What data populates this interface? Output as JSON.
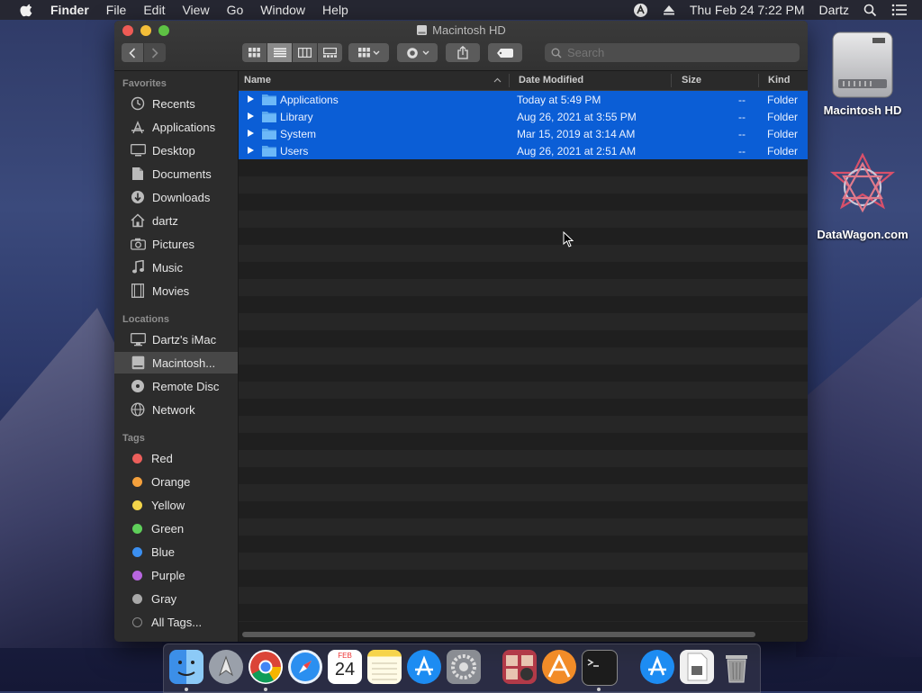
{
  "menubar": {
    "app": "Finder",
    "items": [
      "File",
      "Edit",
      "View",
      "Go",
      "Window",
      "Help"
    ],
    "clock": "Thu Feb 24  7:22 PM",
    "user": "Dartz"
  },
  "window": {
    "title": "Macintosh HD",
    "search_placeholder": "Search"
  },
  "sidebar": {
    "favorites_label": "Favorites",
    "favorites": [
      "Recents",
      "Applications",
      "Desktop",
      "Documents",
      "Downloads",
      "dartz",
      "Pictures",
      "Music",
      "Movies"
    ],
    "locations_label": "Locations",
    "locations": [
      "Dartz's iMac",
      "Macintosh...",
      "Remote Disc",
      "Network"
    ],
    "tags_label": "Tags",
    "tags": [
      {
        "name": "Red",
        "color": "#ec5f5b"
      },
      {
        "name": "Orange",
        "color": "#f4a03c"
      },
      {
        "name": "Yellow",
        "color": "#f3d54a"
      },
      {
        "name": "Green",
        "color": "#5fcf5a"
      },
      {
        "name": "Blue",
        "color": "#3b8ff0"
      },
      {
        "name": "Purple",
        "color": "#b866e0"
      },
      {
        "name": "Gray",
        "color": "#a9a9a9"
      }
    ],
    "all_tags": "All Tags..."
  },
  "columns": {
    "name": "Name",
    "date": "Date Modified",
    "size": "Size",
    "kind": "Kind"
  },
  "rows": [
    {
      "name": "Applications",
      "date": "Today at 5:49 PM",
      "size": "--",
      "kind": "Folder"
    },
    {
      "name": "Library",
      "date": "Aug 26, 2021 at 3:55 PM",
      "size": "--",
      "kind": "Folder"
    },
    {
      "name": "System",
      "date": "Mar 15, 2019 at 3:14 AM",
      "size": "--",
      "kind": "Folder"
    },
    {
      "name": "Users",
      "date": "Aug 26, 2021 at 2:51 AM",
      "size": "--",
      "kind": "Folder"
    }
  ],
  "desktop": {
    "icons": [
      "Macintosh HD",
      "DataWagon.com"
    ]
  },
  "dock": {
    "calendar_month": "FEB",
    "calendar_day": "24"
  },
  "colors": {
    "selection": "#0b5ed6",
    "accent": "#3b8ff0"
  }
}
